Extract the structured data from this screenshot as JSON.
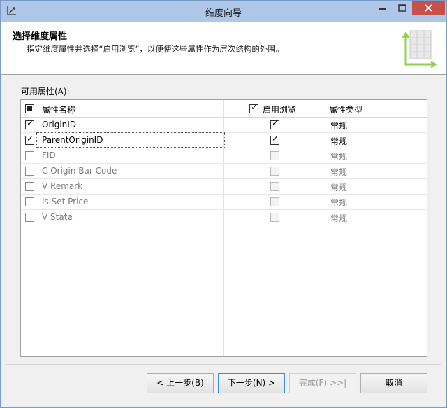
{
  "window": {
    "title": "维度向导"
  },
  "header": {
    "title": "选择维度属性",
    "description": "指定维度属性并选择“启用浏览”，以便使这些属性作为层次结构的外围。"
  },
  "section_label": "可用属性(A):",
  "grid": {
    "columns": {
      "name": "属性名称",
      "browse": "启用浏览",
      "type": "属性类型"
    },
    "rows": [
      {
        "name": "OriginID",
        "type": "常规",
        "checked": true,
        "browse": true,
        "enabled": true
      },
      {
        "name": "ParentOriginID",
        "type": "常规",
        "checked": true,
        "browse": true,
        "enabled": true
      },
      {
        "name": "FID",
        "type": "常规",
        "checked": false,
        "browse": false,
        "enabled": false
      },
      {
        "name": "C Origin Bar Code",
        "type": "常规",
        "checked": false,
        "browse": false,
        "enabled": false
      },
      {
        "name": "V Remark",
        "type": "常规",
        "checked": false,
        "browse": false,
        "enabled": false
      },
      {
        "name": "Is Set Price",
        "type": "常规",
        "checked": false,
        "browse": false,
        "enabled": false
      },
      {
        "name": "V State",
        "type": "常规",
        "checked": false,
        "browse": false,
        "enabled": false
      }
    ]
  },
  "buttons": {
    "back": "< 上一步(B)",
    "next": "下一步(N) >",
    "finish": "完成(F) >>|",
    "cancel": "取消"
  },
  "colors": {
    "titlebar": "#aec6e7",
    "close": "#c7504b",
    "accent": "#3a8fd8"
  }
}
